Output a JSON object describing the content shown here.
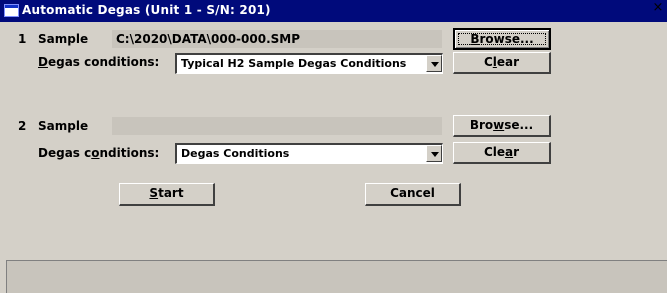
{
  "window": {
    "title": "Automatic Degas (Unit 1 - S/N: 201)",
    "close_label": "×"
  },
  "sample1": {
    "number": "1",
    "sample_label": "Sample",
    "path": "C:\\2020\\DATA\\000-000.SMP",
    "degas_label_prefix": "",
    "degas_label_mnemonic": "D",
    "degas_label_suffix": "egas conditions:",
    "degas_value": "Typical H2 Sample Degas Conditions",
    "browse_prefix": "",
    "browse_mnemonic": "B",
    "browse_suffix": "rowse...",
    "clear_prefix": "C",
    "clear_mnemonic": "l",
    "clear_suffix": "ear"
  },
  "sample2": {
    "number": "2",
    "sample_label": "Sample",
    "path": "",
    "degas_label_prefix": "Degas c",
    "degas_label_mnemonic": "o",
    "degas_label_suffix": "nditions:",
    "degas_value": "Degas Conditions",
    "browse_prefix": "Bro",
    "browse_mnemonic": "w",
    "browse_suffix": "se...",
    "clear_prefix": "Cle",
    "clear_mnemonic": "a",
    "clear_suffix": "r"
  },
  "actions": {
    "start_prefix": "",
    "start_mnemonic": "S",
    "start_suffix": "tart",
    "cancel_label": "Cancel"
  },
  "status": {
    "text": ""
  }
}
